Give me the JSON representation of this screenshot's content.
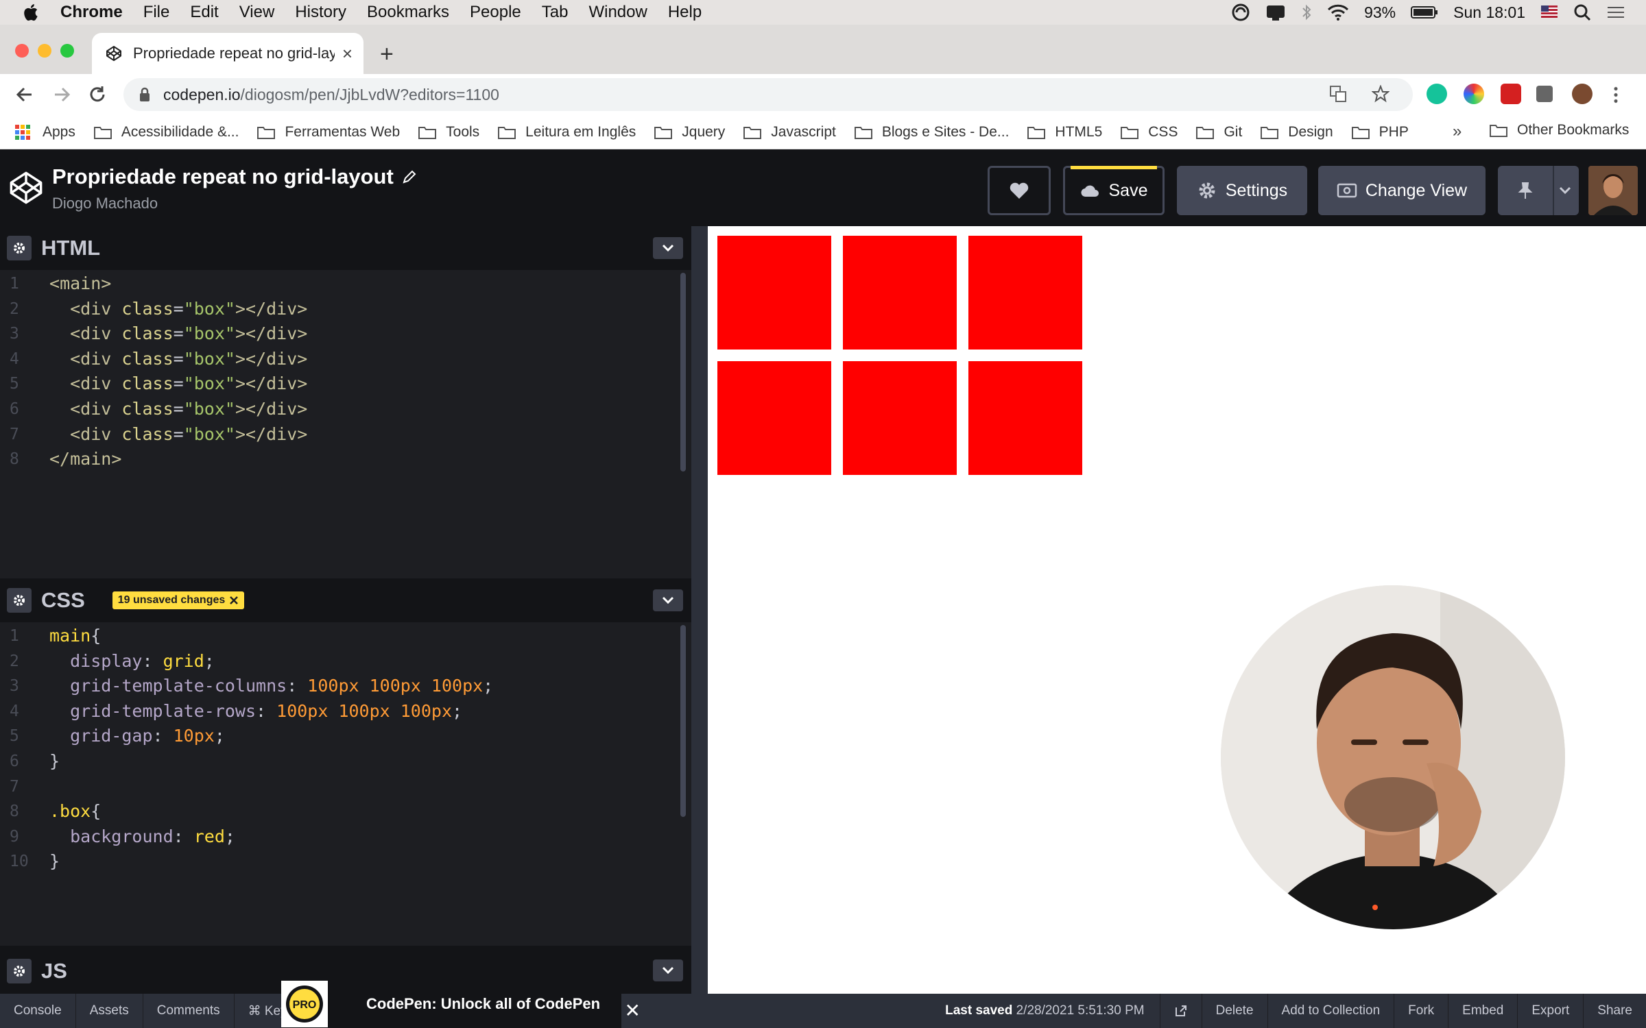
{
  "macos": {
    "menu": [
      "Chrome",
      "File",
      "Edit",
      "View",
      "History",
      "Bookmarks",
      "People",
      "Tab",
      "Window",
      "Help"
    ],
    "battery": "93%",
    "clock": "Sun 18:01"
  },
  "browser": {
    "tab_title": "Propriedade repeat no grid-layout",
    "tab_close": "×",
    "new_tab": "+",
    "url_host": "codepen.io",
    "url_path": "/diogosm/pen/JjbLvdW?editors=1100",
    "bookmarks": [
      "Acessibilidade &...",
      "Ferramentas Web",
      "Tools",
      "Leitura em Inglês",
      "Jquery",
      "Javascript",
      "Blogs e Sites - De...",
      "HTML5",
      "CSS",
      "Git",
      "Design",
      "PHP"
    ],
    "apps_label": "Apps",
    "more": "»",
    "other_bookmarks": "Other Bookmarks"
  },
  "codepen": {
    "pen_title": "Propriedade repeat no grid-layout",
    "author": "Diogo Machado",
    "save_label": "Save",
    "settings_label": "Settings",
    "change_view_label": "Change View"
  },
  "editors": {
    "html": {
      "label": "HTML",
      "lines": [
        [
          [
            "t-ang",
            "<"
          ],
          [
            "t-tag",
            "main"
          ],
          [
            "t-ang",
            ">"
          ]
        ],
        [
          [
            "t-ang",
            "  <"
          ],
          [
            "t-tag",
            "div "
          ],
          [
            "t-attr",
            "class"
          ],
          [
            "t-punc",
            "="
          ],
          [
            "t-str",
            "\"box\""
          ],
          [
            "t-ang",
            "></"
          ],
          [
            "t-tag",
            "div"
          ],
          [
            "t-ang",
            ">"
          ]
        ],
        [
          [
            "t-ang",
            "  <"
          ],
          [
            "t-tag",
            "div "
          ],
          [
            "t-attr",
            "class"
          ],
          [
            "t-punc",
            "="
          ],
          [
            "t-str",
            "\"box\""
          ],
          [
            "t-ang",
            "></"
          ],
          [
            "t-tag",
            "div"
          ],
          [
            "t-ang",
            ">"
          ]
        ],
        [
          [
            "t-ang",
            "  <"
          ],
          [
            "t-tag",
            "div "
          ],
          [
            "t-attr",
            "class"
          ],
          [
            "t-punc",
            "="
          ],
          [
            "t-str",
            "\"box\""
          ],
          [
            "t-ang",
            "></"
          ],
          [
            "t-tag",
            "div"
          ],
          [
            "t-ang",
            ">"
          ]
        ],
        [
          [
            "t-ang",
            "  <"
          ],
          [
            "t-tag",
            "div "
          ],
          [
            "t-attr",
            "class"
          ],
          [
            "t-punc",
            "="
          ],
          [
            "t-str",
            "\"box\""
          ],
          [
            "t-ang",
            "></"
          ],
          [
            "t-tag",
            "div"
          ],
          [
            "t-ang",
            ">"
          ]
        ],
        [
          [
            "t-ang",
            "  <"
          ],
          [
            "t-tag",
            "div "
          ],
          [
            "t-attr",
            "class"
          ],
          [
            "t-punc",
            "="
          ],
          [
            "t-str",
            "\"box\""
          ],
          [
            "t-ang",
            "></"
          ],
          [
            "t-tag",
            "div"
          ],
          [
            "t-ang",
            ">"
          ]
        ],
        [
          [
            "t-ang",
            "  <"
          ],
          [
            "t-tag",
            "div "
          ],
          [
            "t-attr",
            "class"
          ],
          [
            "t-punc",
            "="
          ],
          [
            "t-str",
            "\"box\""
          ],
          [
            "t-ang",
            "></"
          ],
          [
            "t-tag",
            "div"
          ],
          [
            "t-ang",
            ">"
          ]
        ],
        [
          [
            "t-ang",
            "</"
          ],
          [
            "t-tag",
            "main"
          ],
          [
            "t-ang",
            ">"
          ]
        ]
      ]
    },
    "css": {
      "label": "CSS",
      "unsaved": "19 unsaved changes",
      "lines": [
        [
          [
            "t-sel",
            "main"
          ],
          [
            "t-brace",
            "{"
          ]
        ],
        [
          [
            "t-prop",
            "  display"
          ],
          [
            "t-punc",
            ": "
          ],
          [
            "t-val",
            "grid"
          ],
          [
            "t-punc",
            ";"
          ]
        ],
        [
          [
            "t-prop",
            "  grid-template-columns"
          ],
          [
            "t-punc",
            ": "
          ],
          [
            "t-num",
            "100px 100px 100px"
          ],
          [
            "t-punc",
            ";"
          ]
        ],
        [
          [
            "t-prop",
            "  grid-template-rows"
          ],
          [
            "t-punc",
            ": "
          ],
          [
            "t-num",
            "100px 100px 100px"
          ],
          [
            "t-punc",
            ";"
          ]
        ],
        [
          [
            "t-prop",
            "  grid-gap"
          ],
          [
            "t-punc",
            ": "
          ],
          [
            "t-num",
            "10px"
          ],
          [
            "t-punc",
            ";"
          ]
        ],
        [
          [
            "t-brace",
            "}"
          ]
        ],
        [
          [
            "t-punc",
            ""
          ]
        ],
        [
          [
            "t-sel",
            ".box"
          ],
          [
            "t-brace",
            "{"
          ]
        ],
        [
          [
            "t-prop",
            "  background"
          ],
          [
            "t-punc",
            ": "
          ],
          [
            "t-val",
            "red"
          ],
          [
            "t-punc",
            ";"
          ]
        ],
        [
          [
            "t-brace",
            "}"
          ]
        ]
      ]
    },
    "js": {
      "label": "JS"
    }
  },
  "preview": {
    "box_count": 6,
    "box_color": "#ff0000"
  },
  "bottom": {
    "console": "Console",
    "assets": "Assets",
    "comments": "Comments",
    "keys": "⌘ Keys",
    "pro_badge": "PRO",
    "pro_text": "CodePen: Unlock all of CodePen",
    "last_saved_label": "Last saved",
    "last_saved_value": "2/28/2021 5:51:30 PM",
    "delete": "Delete",
    "add_to_collection": "Add to Collection",
    "fork": "Fork",
    "embed": "Embed",
    "export": "Export",
    "share": "Share"
  }
}
